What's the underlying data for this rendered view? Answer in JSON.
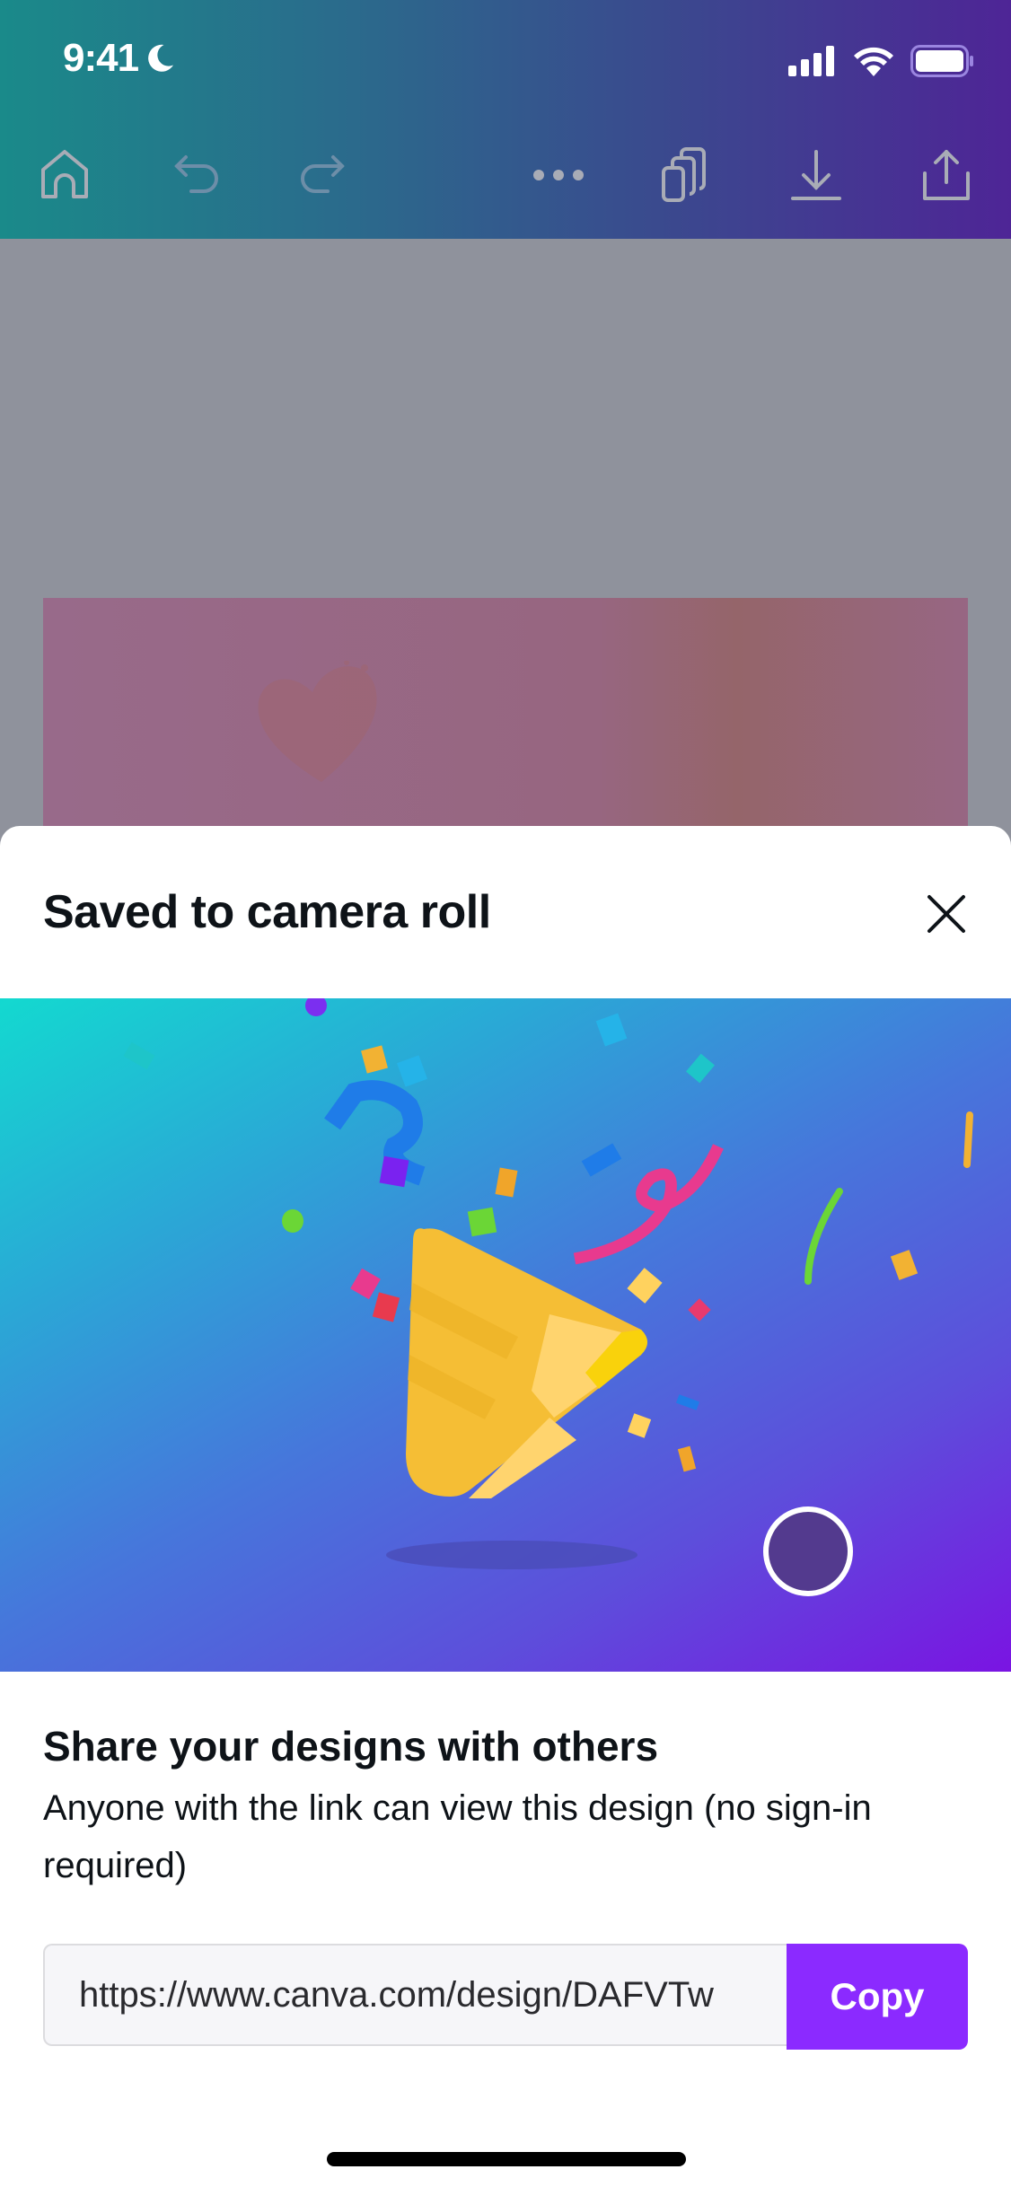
{
  "status_bar": {
    "time": "9:41",
    "focus_icon": "moon-icon",
    "icons": [
      "cellular-signal-icon",
      "wifi-icon",
      "battery-icon"
    ]
  },
  "toolbar": {
    "colors": {
      "gradient_start": "#1a8a8a",
      "gradient_end": "#4e2596"
    },
    "items": [
      {
        "name": "home",
        "icon": "home-icon",
        "enabled": true
      },
      {
        "name": "undo",
        "icon": "undo-icon",
        "enabled": false
      },
      {
        "name": "redo",
        "icon": "redo-icon",
        "enabled": false
      },
      {
        "name": "more",
        "icon": "more-dots-icon",
        "enabled": true
      },
      {
        "name": "pages",
        "icon": "pages-icon",
        "enabled": true
      },
      {
        "name": "download",
        "icon": "download-icon",
        "enabled": true
      },
      {
        "name": "share",
        "icon": "share-icon",
        "enabled": true
      }
    ]
  },
  "sheet": {
    "title": "Saved to camera roll",
    "close_icon": "close-icon",
    "illustration": "party-popper-confetti",
    "share_heading": "Share your designs with others",
    "share_description": "Anyone with the link can view this design (no sign-in required)",
    "link_value": "https://www.canva.com/design/DAFVTw",
    "copy_label": "Copy",
    "colors": {
      "accent": "#8b2aff",
      "input_bg": "#f6f6f9"
    }
  }
}
